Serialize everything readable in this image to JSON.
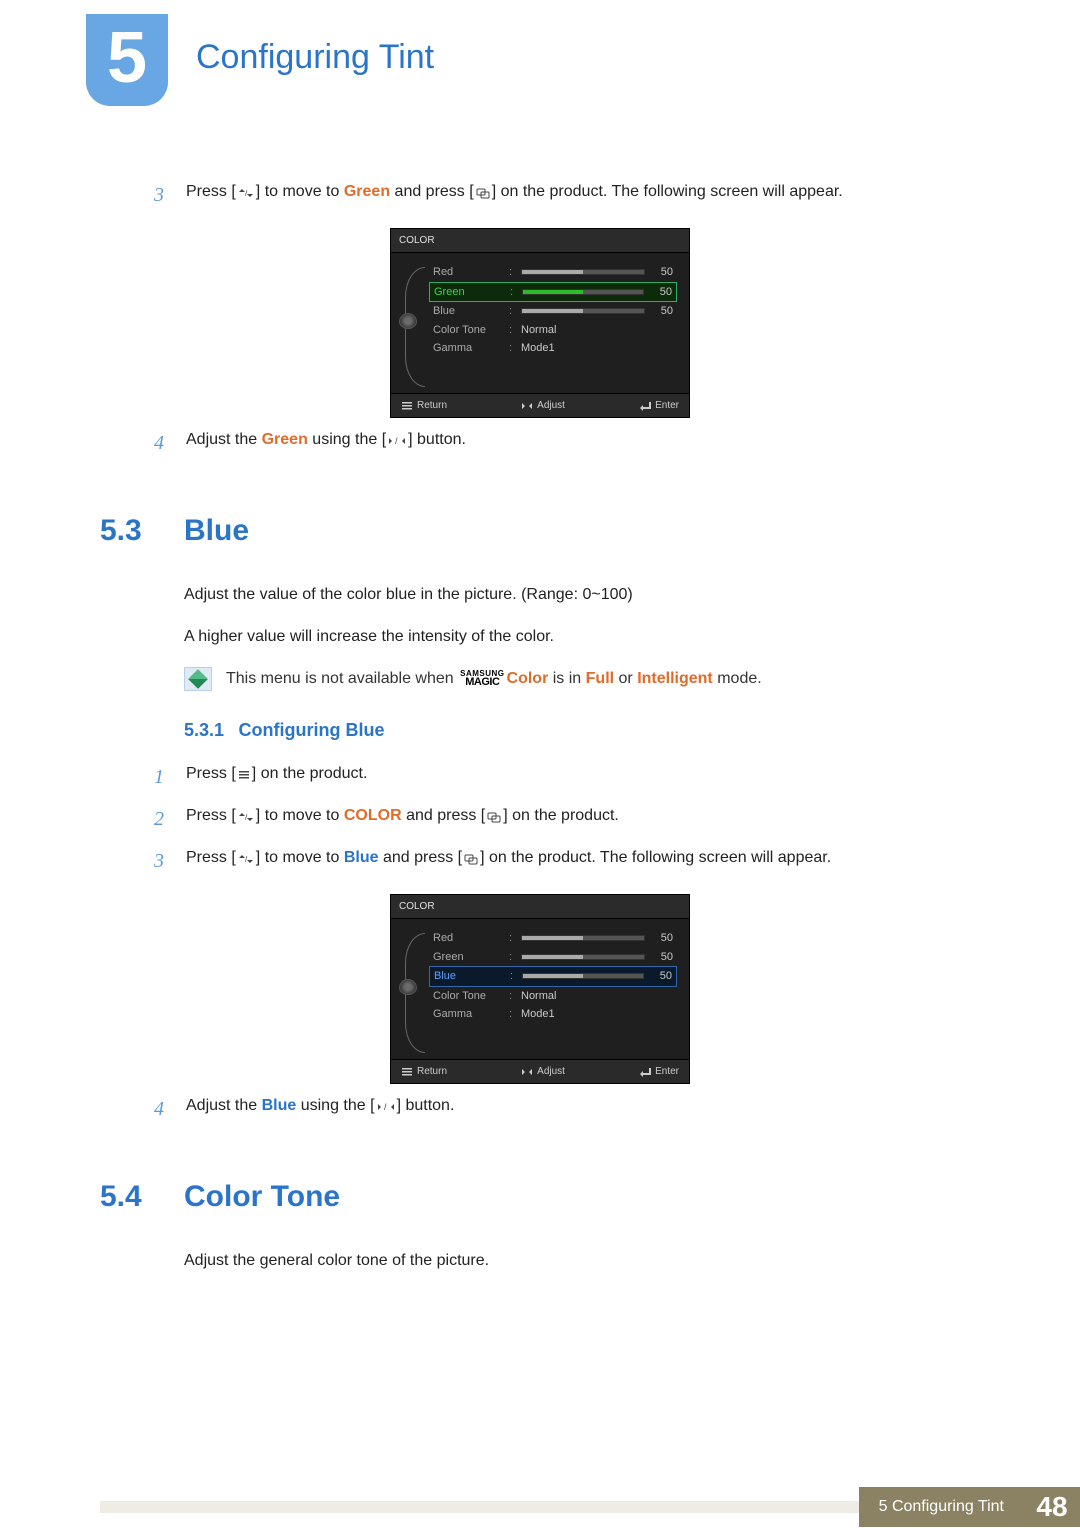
{
  "chapter": {
    "number": "5",
    "title": "Configuring Tint"
  },
  "top_steps": {
    "s3": {
      "num": "3",
      "pre": "Press [",
      "mid1": "] to move to ",
      "green": "Green",
      "mid2": " and press [",
      "post": "] on the product. The following screen will appear."
    },
    "s4": {
      "num": "4",
      "pre": "Adjust the ",
      "green": "Green",
      "mid": " using the [",
      "post": "] button."
    }
  },
  "osd": {
    "title": "COLOR",
    "rows": {
      "red": {
        "label": "Red",
        "value": "50"
      },
      "green": {
        "label": "Green",
        "value": "50"
      },
      "blue": {
        "label": "Blue",
        "value": "50"
      },
      "tone": {
        "label": "Color Tone",
        "value": "Normal"
      },
      "gamma": {
        "label": "Gamma",
        "value": "Mode1"
      }
    },
    "footer": {
      "return": "Return",
      "adjust": "Adjust",
      "enter": "Enter"
    }
  },
  "sec53": {
    "num": "5.3",
    "title": "Blue",
    "p1": "Adjust the value of the color blue in the picture. (Range: 0~100)",
    "p2": "A higher value will increase the intensity of the color.",
    "note": {
      "pre": "This menu is not available when ",
      "magic_top": "SAMSUNG",
      "magic_bot": "MAGIC",
      "color_word": "Color",
      "mid": " is in ",
      "full": "Full",
      "or": " or ",
      "intel": "Intelligent",
      "post": " mode."
    },
    "sub": {
      "num": "5.3.1",
      "title": "Configuring Blue"
    },
    "steps": {
      "s1": {
        "num": "1",
        "pre": "Press [",
        "post": "] on the product."
      },
      "s2": {
        "num": "2",
        "pre": "Press [",
        "mid1": "] to move to ",
        "color": "COLOR",
        "mid2": " and press [",
        "post": "] on the product."
      },
      "s3": {
        "num": "3",
        "pre": "Press [",
        "mid1": "] to move to ",
        "blue": "Blue",
        "mid2": " and press [",
        "post": "] on the product. The following screen will appear."
      },
      "s4": {
        "num": "4",
        "pre": "Adjust the ",
        "blue": "Blue",
        "mid": " using the [",
        "post": "] button."
      }
    }
  },
  "sec54": {
    "num": "5.4",
    "title": "Color Tone",
    "p1": "Adjust the general color tone of the picture."
  },
  "footer": {
    "label": "5 Configuring Tint",
    "page": "48"
  }
}
